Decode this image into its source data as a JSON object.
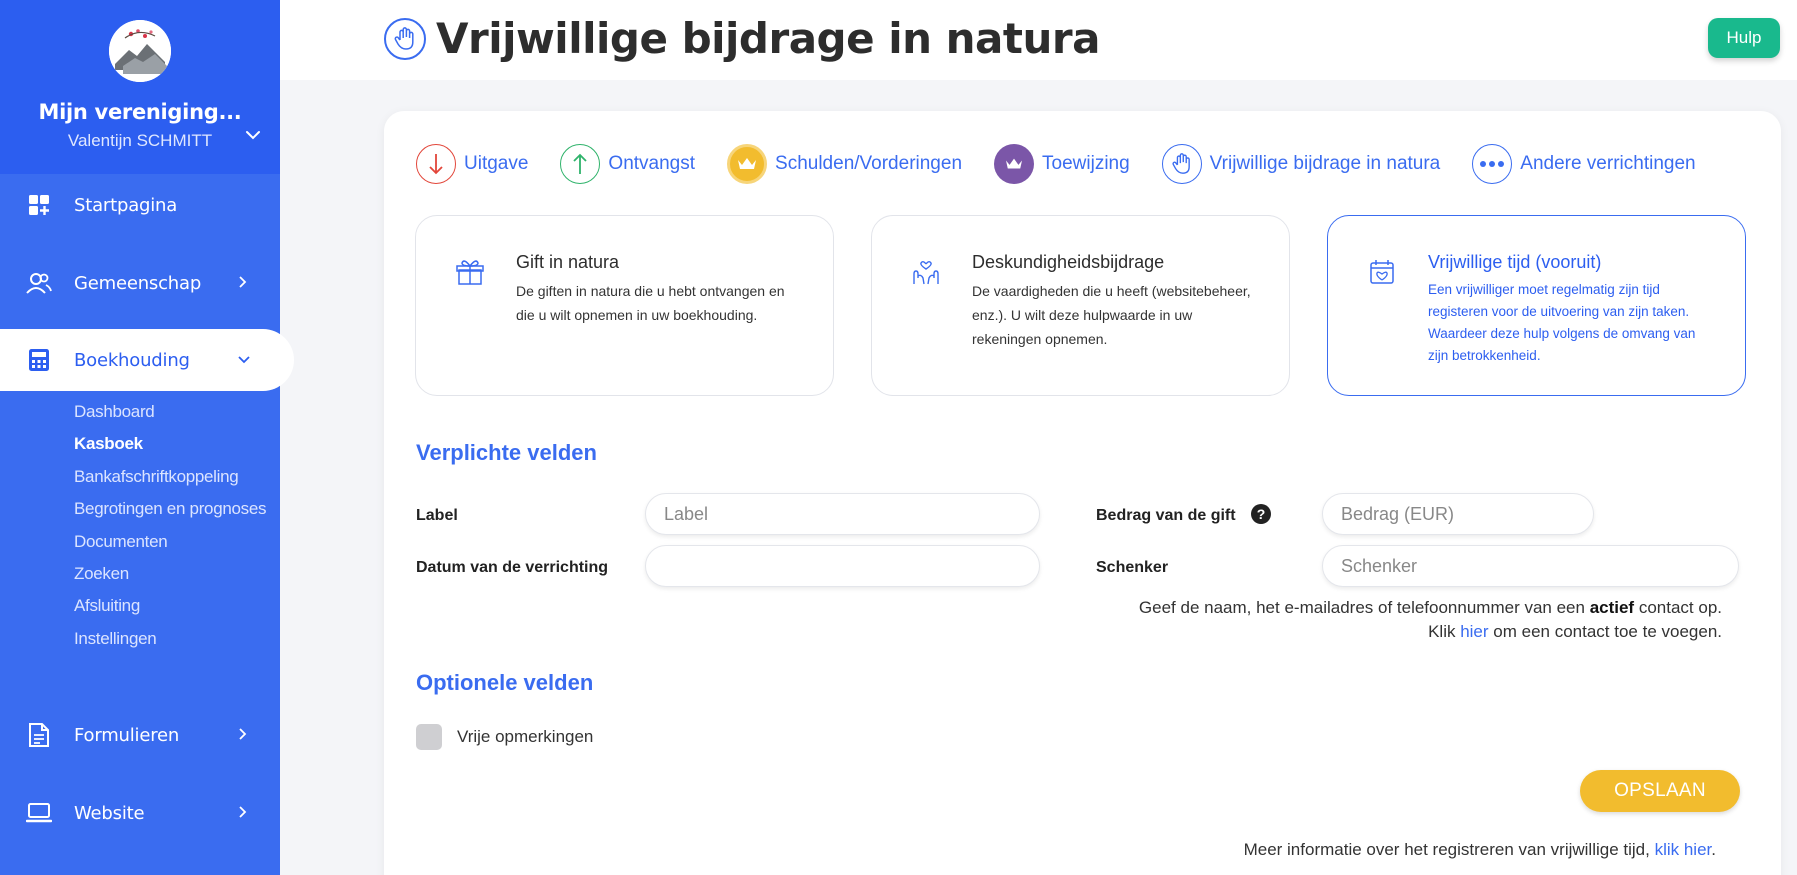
{
  "sidebar": {
    "org_name": "Mijn vereniging...",
    "user_name": "Valentijn SCHMITT",
    "nav": [
      {
        "label": "Startpagina",
        "icon": "dashboard-icon"
      },
      {
        "label": "Gemeenschap",
        "icon": "users-icon"
      },
      {
        "label": "Boekhouding",
        "icon": "calculator-icon"
      },
      {
        "label": "Formulieren",
        "icon": "document-icon"
      },
      {
        "label": "Website",
        "icon": "laptop-icon"
      }
    ],
    "sub_items": [
      "Dashboard",
      "Kasboek",
      "Bankafschriftkoppeling",
      "Begrotingen en prognoses",
      "Documenten",
      "Zoeken",
      "Afsluiting",
      "Instellingen"
    ]
  },
  "header": {
    "title": "Vrijwillige bijdrage in natura",
    "help_label": "Hulp"
  },
  "tabs": [
    {
      "label": "Uitgave",
      "color": "#e2463a"
    },
    {
      "label": "Ontvangst",
      "color": "#2fb36b"
    },
    {
      "label": "Schulden/Vorderingen",
      "color": "#f2bc2e"
    },
    {
      "label": "Toewijzing",
      "color": "#7b56a8"
    },
    {
      "label": "Vrijwillige bijdrage in natura",
      "color": "#3a6cf0"
    },
    {
      "label": "Andere verrichtingen",
      "color": "#3a6cf0"
    }
  ],
  "type_cards": [
    {
      "title": "Gift in natura",
      "desc": "De giften in natura die u hebt ontvangen en die u wilt opnemen in uw boekhouding."
    },
    {
      "title": "Deskundigheidsbijdrage",
      "desc": "De vaardigheden die u heeft (websitebeheer, enz.). U wilt deze hulpwaarde in uw rekeningen opnemen."
    },
    {
      "title": "Vrijwillige tijd (vooruit)",
      "desc": "Een vrijwilliger moet regelmatig zijn tijd registeren voor de uitvoering van zijn taken. Waardeer deze hulp volgens de omvang van zijn betrokkenheid."
    }
  ],
  "form": {
    "required_title": "Verplichte velden",
    "label_label": "Label",
    "label_placeholder": "Label",
    "date_label": "Datum van de verrichting",
    "date_value": "",
    "amount_label": "Bedrag van de gift",
    "amount_placeholder": "Bedrag (EUR)",
    "donor_label": "Schenker",
    "donor_placeholder": "Schenker",
    "hint_line1_pre": "Geef de naam, het e-mailadres of telefoonnummer van een ",
    "hint_line1_bold": "actief",
    "hint_line1_post": " contact op.",
    "hint_line2_pre": "Klik ",
    "hint_line2_link": "hier",
    "hint_line2_post": " om een contact toe te voegen.",
    "optional_title": "Optionele velden",
    "free_remarks_label": "Vrije opmerkingen",
    "save_label": "OPSLAAN",
    "footer_pre": "Meer informatie over het registreren van vrijwillige tijd, ",
    "footer_link": "klik hier",
    "footer_post": "."
  }
}
